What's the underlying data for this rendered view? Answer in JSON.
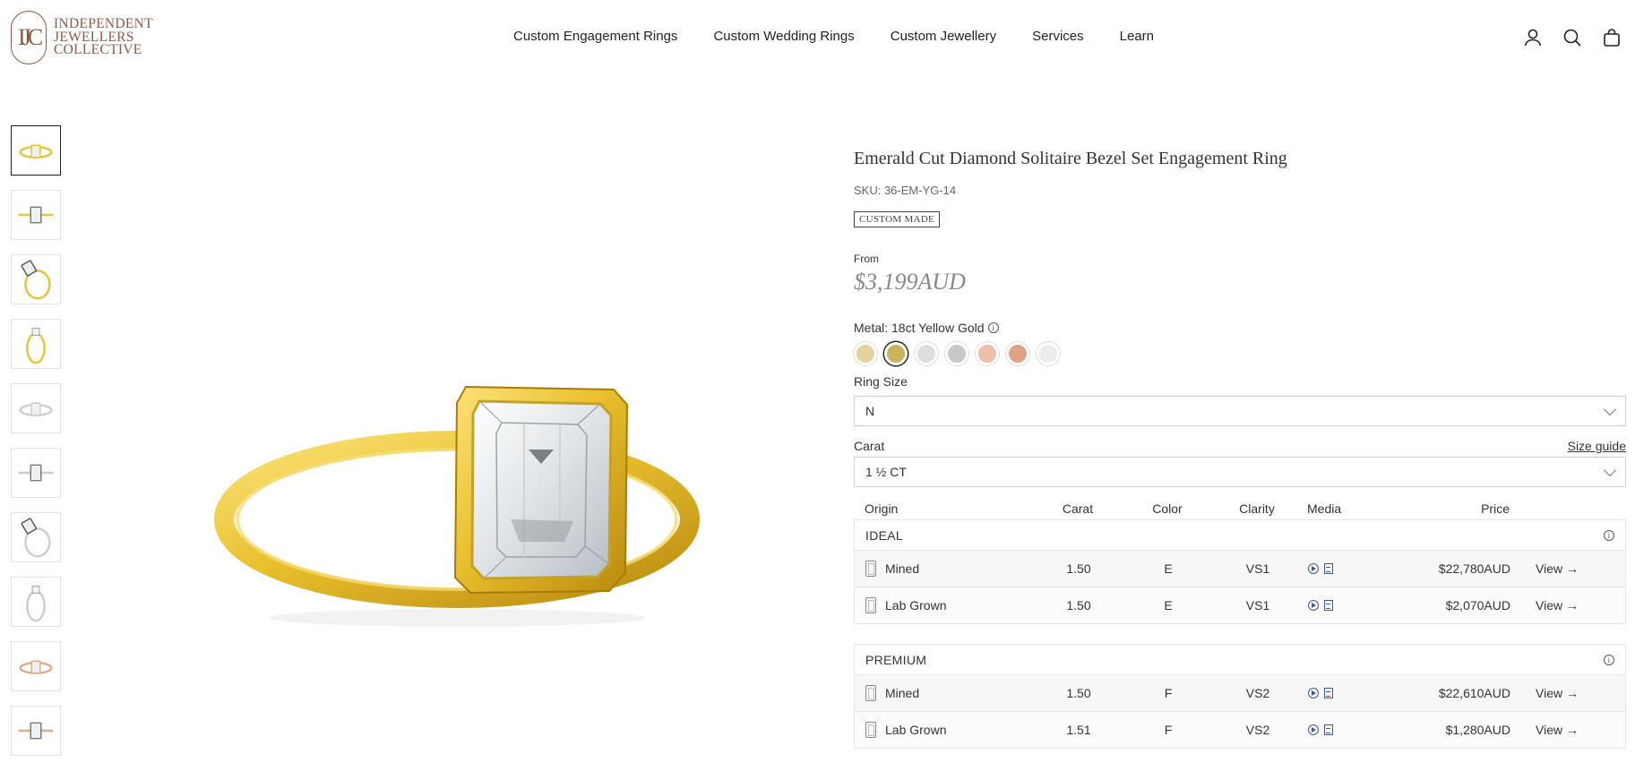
{
  "brand": {
    "mark": "IJC",
    "lines": [
      "INDEPENDENT",
      "JEWELLERS",
      "COLLECTIVE"
    ]
  },
  "nav": {
    "items": [
      "Custom Engagement Rings",
      "Custom Wedding Rings",
      "Custom Jewellery",
      "Services",
      "Learn"
    ]
  },
  "header_icons": [
    "account-icon",
    "search-icon",
    "bag-icon"
  ],
  "product": {
    "title": "Emerald Cut Diamond Solitaire Bezel Set Engagement Ring",
    "sku": "SKU: 36-EM-YG-14",
    "badge": "CUSTOM MADE",
    "from_label": "From",
    "price": "$3,199AUD",
    "metal_label": "Metal: 18ct Yellow Gold",
    "info_glyph": "i",
    "swatch_colors": [
      "#e6d39c",
      "#c9b65a",
      "#dedede",
      "#c8c8c8",
      "#efbfa9",
      "#dfa287",
      "#ececec"
    ],
    "active_swatch": 1,
    "ring_size_label": "Ring Size",
    "ring_size_value": "N",
    "carat_label": "Carat",
    "size_guide": "Size guide",
    "carat_value": "1 ½ CT"
  },
  "table": {
    "headers": {
      "origin": "Origin",
      "carat": "Carat",
      "color": "Color",
      "clarity": "Clarity",
      "media": "Media",
      "price": "Price"
    },
    "groups": [
      {
        "name": "IDEAL",
        "rows": [
          {
            "origin": "Mined",
            "carat": "1.50",
            "color": "E",
            "clarity": "VS1",
            "price": "$22,780AUD",
            "view": "View →"
          },
          {
            "origin": "Lab Grown",
            "carat": "1.50",
            "color": "E",
            "clarity": "VS1",
            "price": "$2,070AUD",
            "view": "View →"
          }
        ]
      },
      {
        "name": "PREMIUM",
        "rows": [
          {
            "origin": "Mined",
            "carat": "1.50",
            "color": "F",
            "clarity": "VS2",
            "price": "$22,610AUD",
            "view": "View →"
          },
          {
            "origin": "Lab Grown",
            "carat": "1.51",
            "color": "F",
            "clarity": "VS2",
            "price": "$1,280AUD",
            "view": "View →"
          }
        ]
      }
    ]
  },
  "thumbnails": [
    {
      "metal": "yellow",
      "view": "angle"
    },
    {
      "metal": "yellow",
      "view": "top"
    },
    {
      "metal": "yellow",
      "view": "side"
    },
    {
      "metal": "yellow",
      "view": "profile"
    },
    {
      "metal": "white",
      "view": "angle"
    },
    {
      "metal": "white",
      "view": "top"
    },
    {
      "metal": "white",
      "view": "side"
    },
    {
      "metal": "white",
      "view": "profile"
    },
    {
      "metal": "rose",
      "view": "angle"
    },
    {
      "metal": "rose",
      "view": "top"
    }
  ]
}
